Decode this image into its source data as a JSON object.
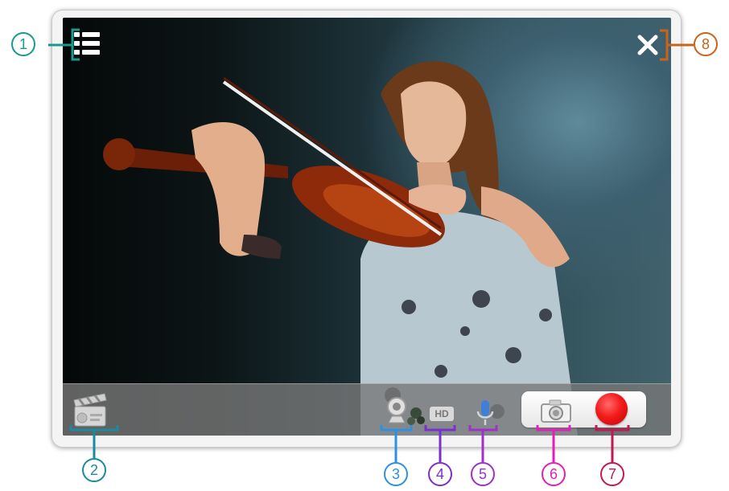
{
  "window": {
    "menu_icon": "list-icon",
    "close_icon": "close-icon"
  },
  "toolbar": {
    "clapper_icon": "clapperboard-icon",
    "webcam_icon": "webcam-icon",
    "hd_label": "HD",
    "mic_icon": "microphone-icon",
    "camera_icon": "camera-icon",
    "record_icon": "record-icon"
  },
  "callouts": [
    {
      "number": "1",
      "color": "#1a9a8a"
    },
    {
      "number": "2",
      "color": "#1a8aa0"
    },
    {
      "number": "3",
      "color": "#2f8fe0"
    },
    {
      "number": "4",
      "color": "#7a2fd0"
    },
    {
      "number": "5",
      "color": "#a030c8"
    },
    {
      "number": "6",
      "color": "#e020b8"
    },
    {
      "number": "7",
      "color": "#c01850"
    },
    {
      "number": "8",
      "color": "#c8641a"
    }
  ],
  "colors": {
    "record": "#f31c1c",
    "toolbar_bg": "#787878"
  }
}
